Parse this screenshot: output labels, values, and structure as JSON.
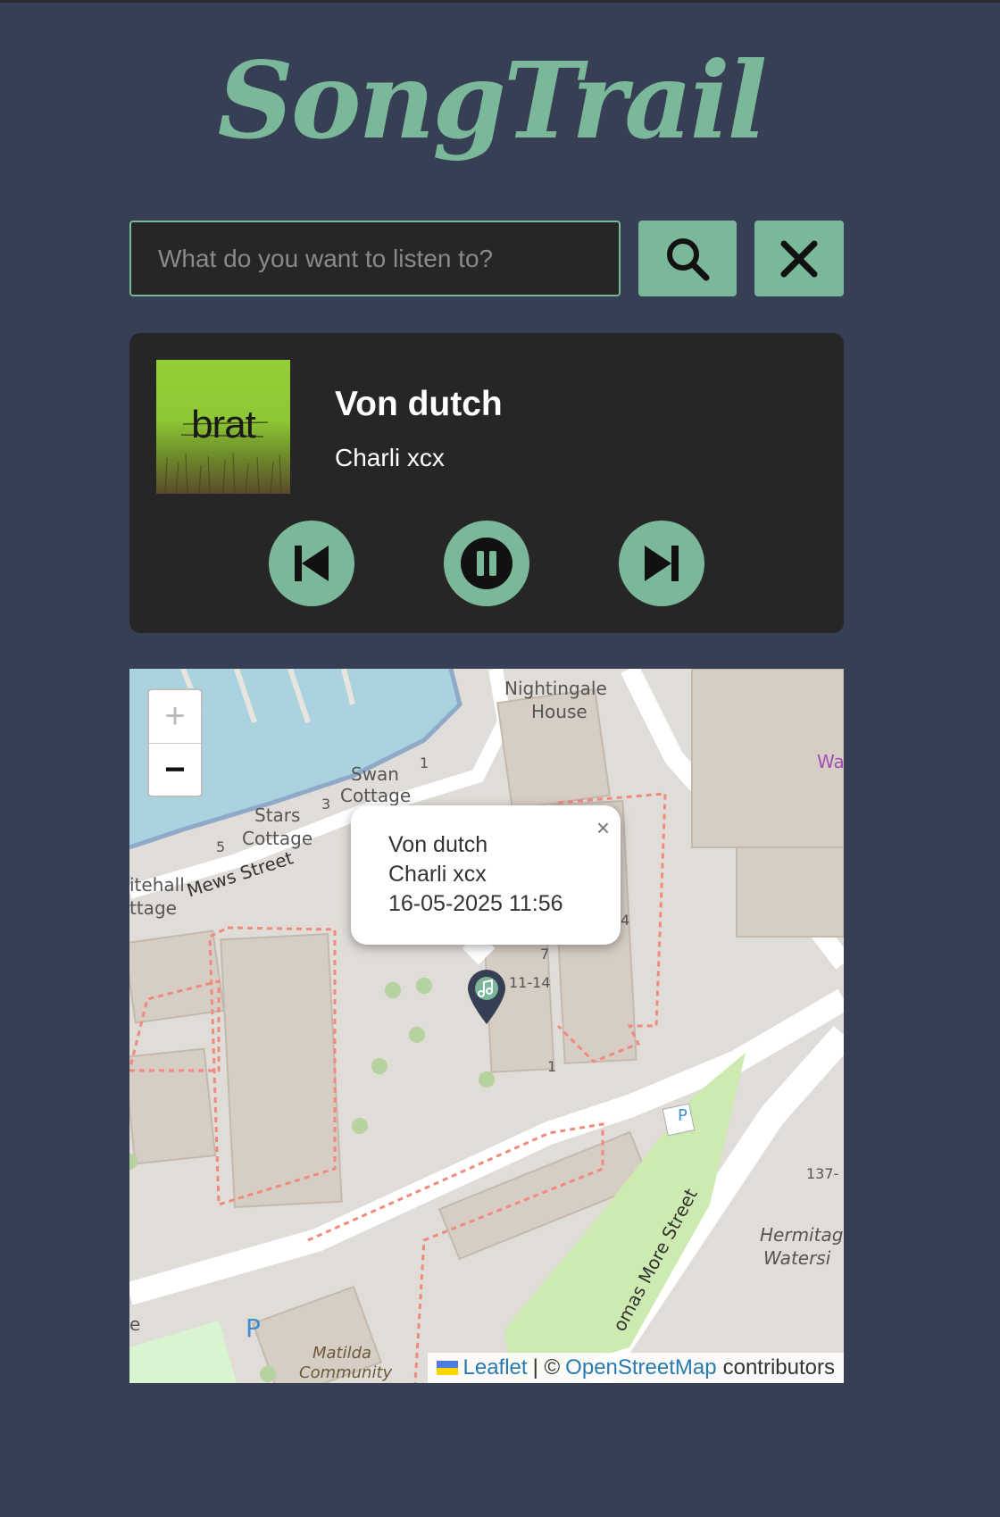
{
  "app": {
    "title": "SongTrail"
  },
  "search": {
    "placeholder": "What do you want to listen to?",
    "value": ""
  },
  "icons": {
    "search": "search-icon",
    "clear": "close-icon",
    "previous": "skip-previous-icon",
    "pause": "pause-icon",
    "next": "skip-next-icon",
    "marker": "music-note-marker-icon"
  },
  "player": {
    "cover_text": "brat",
    "title": "Von dutch",
    "artist": "Charli xcx"
  },
  "map": {
    "zoom_in": "+",
    "zoom_out": "−",
    "labels": {
      "nightingale": "Nightingale",
      "house": "House",
      "swan": "Swan",
      "cottage1": "Cottage",
      "stars": "Stars",
      "cottage2": "Cottage",
      "mews": "Mews Street",
      "itehall": "itehall",
      "ttage": "ttage",
      "num_1a": "1",
      "num_3": "3",
      "num_5": "5",
      "num_4": "4",
      "num_7": "7",
      "num_1114": "11-14",
      "num_1b": "1",
      "num_137": "137-",
      "wa": "Wa",
      "hermitage": "Hermitag",
      "waterside": "Watersi",
      "thomas_more": "omas More Street",
      "matilda": "Matilda",
      "community": "Community",
      "parking_1": "P",
      "parking_2": "P",
      "e_edge": "e"
    },
    "popup": {
      "title": "Von dutch",
      "artist": "Charli xcx",
      "timestamp": "16-05-2025 11:56",
      "close": "×"
    },
    "attribution": {
      "leaflet": "Leaflet",
      "separator": "| ©",
      "osm": "OpenStreetMap",
      "contributors": "contributors"
    }
  },
  "colors": {
    "background": "#363f54",
    "accent": "#7ab899",
    "panel": "#262626"
  }
}
